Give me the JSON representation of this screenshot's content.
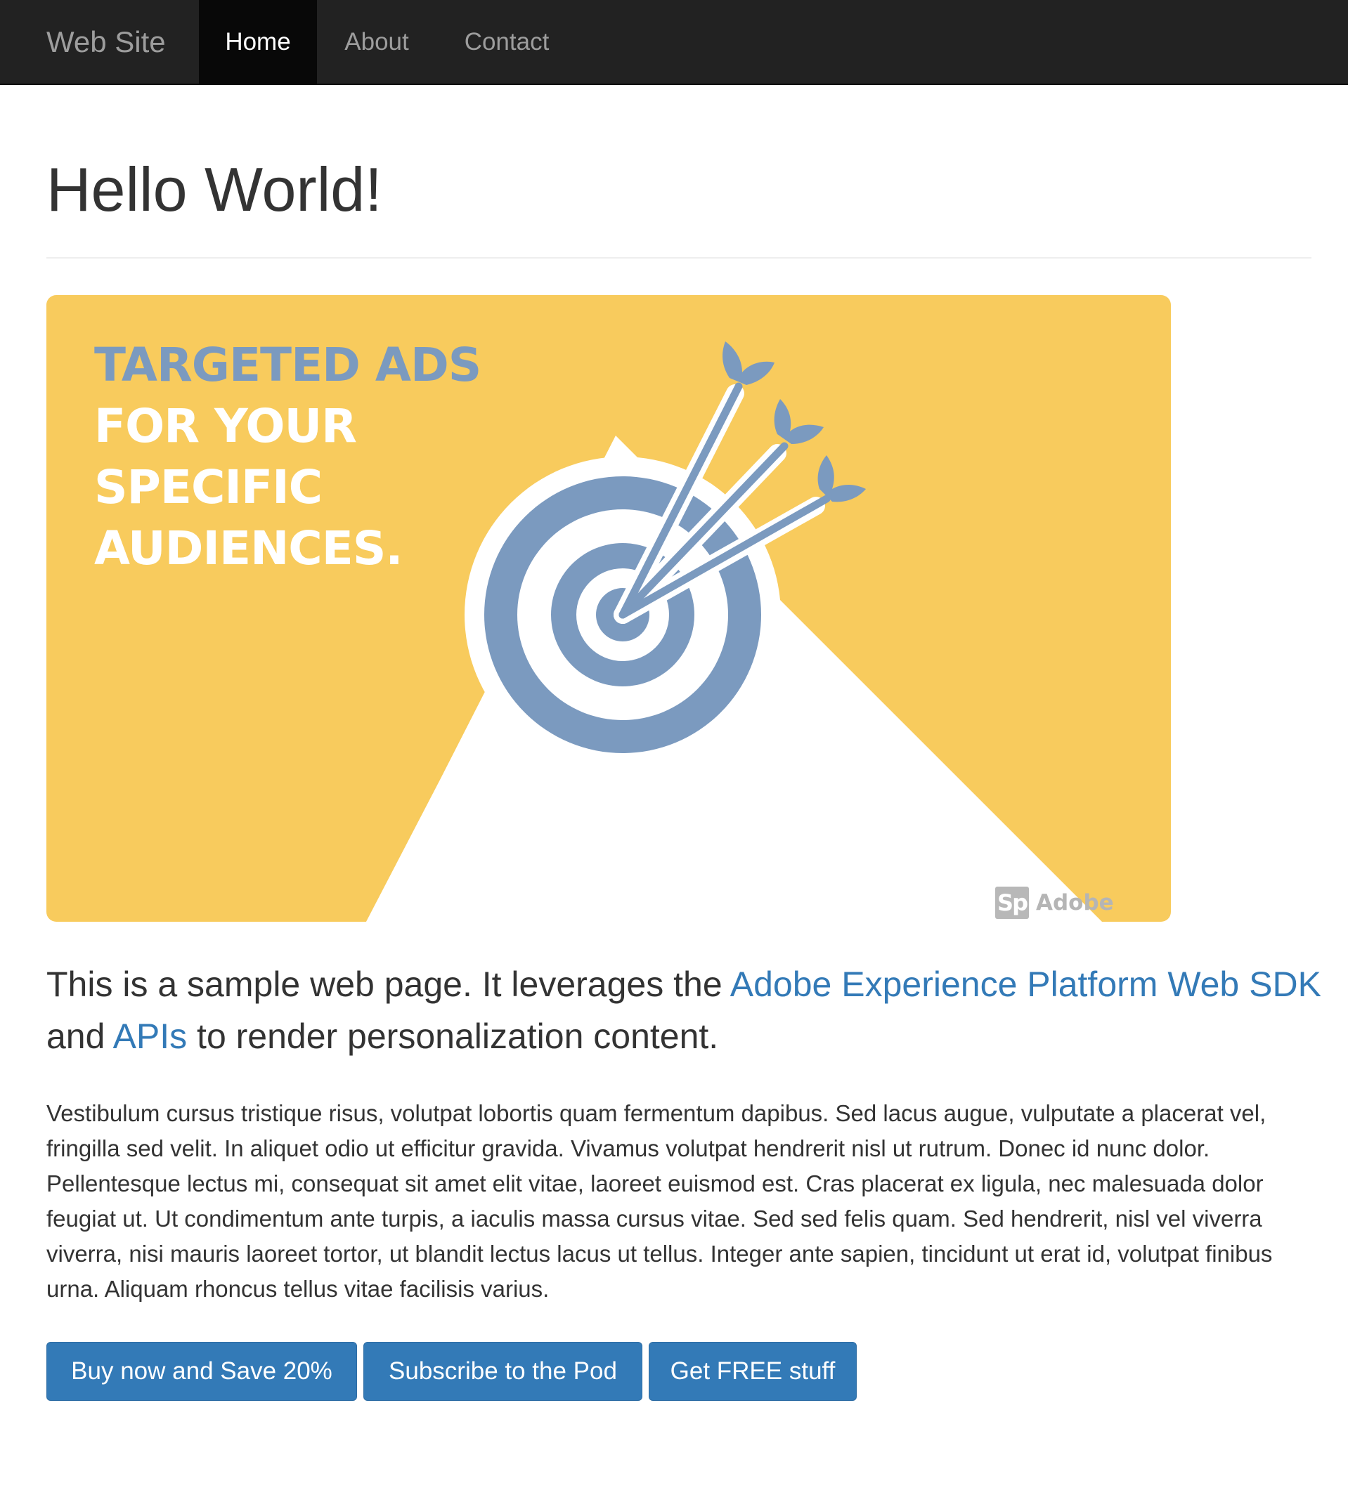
{
  "navbar": {
    "brand": "Web Site",
    "items": [
      {
        "label": "Home",
        "active": true
      },
      {
        "label": "About",
        "active": false
      },
      {
        "label": "Contact",
        "active": false
      }
    ]
  },
  "header": {
    "title": "Hello World!"
  },
  "banner": {
    "headline": [
      "TARGETED ADS",
      "FOR YOUR",
      "SPECIFIC",
      "AUDIENCES."
    ],
    "badge": "Sp",
    "watermark": "Adobe Spark",
    "colors": {
      "background": "#f8cb5d",
      "target": "#7b9abf",
      "highlight": "#ffffff"
    }
  },
  "lead": {
    "text_1": "This is a sample web page. It leverages the ",
    "link_1": "Adobe Experience Platform Web SDK",
    "text_2": " and ",
    "link_2": "APIs",
    "text_3": " to render personalization content."
  },
  "body": {
    "paragraph": "Vestibulum cursus tristique risus, volutpat lobortis quam fermentum dapibus. Sed lacus augue, vulputate a placerat vel, fringilla sed velit. In aliquet odio ut efficitur gravida. Vivamus volutpat hendrerit nisl ut rutrum. Donec id nunc dolor. Pellentesque lectus mi, consequat sit amet elit vitae, laoreet euismod est. Cras placerat ex ligula, nec malesuada dolor feugiat ut. Ut condimentum ante turpis, a iaculis massa cursus vitae. Sed sed felis quam. Sed hendrerit, nisl vel viverra viverra, nisi mauris laoreet tortor, ut blandit lectus lacus ut tellus. Integer ante sapien, tincidunt ut erat id, volutpat finibus urna. Aliquam rhoncus tellus vitae facilisis varius."
  },
  "buttons": [
    {
      "label": "Buy now and Save 20%"
    },
    {
      "label": "Subscribe to the Pod"
    },
    {
      "label": "Get FREE stuff"
    }
  ],
  "theme": {
    "navbar_bg": "#222222",
    "link_color": "#337ab7",
    "button_bg": "#337ab7"
  }
}
